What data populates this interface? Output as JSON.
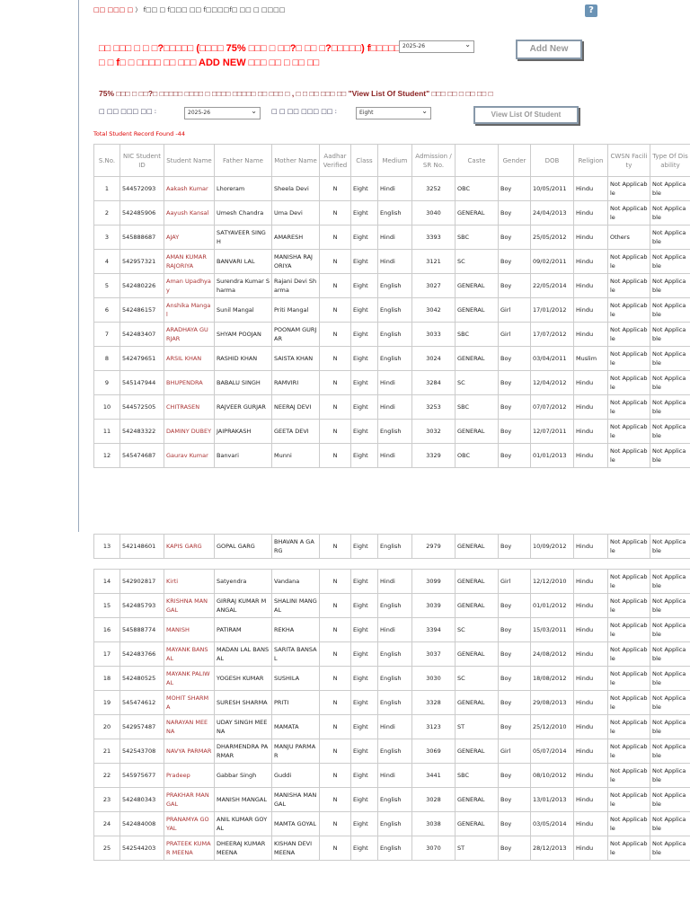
{
  "breadcrumb": {
    "home": "□□ □□□ □",
    "current": "f□□ □ f□□□ □□ f□□□□f□ □□ □ □□□□"
  },
  "help_icon": "?",
  "notice": "□□ □□□ □ □ □?□□□□□ (□□□□ 75% □□□ □ □□?□ □□ □?□□□□□) f□□□□□ □ □ f□ □ □□□□ □□ □□□ ADD NEW □□□ □□ □ □□ □□",
  "year_select": "2025-26",
  "add_new": "Add New",
  "info": "75% □□□ □ □□?□ □□□□□ □□□□ □ □□□□ □□□□□ □□ □□□ □ , □ □ □□ □□□ □□ \"View List Of Student\" □□□ □□ □ □□ □□ □",
  "filter": {
    "year_label": "□ □□ □□□ □□ :",
    "year_value": "2025-26",
    "class_label": "□ □ □□ □□□ □□ :",
    "class_value": "Eight",
    "view_button": "View List Of Student"
  },
  "total": "Total Student Record Found -44",
  "headers": [
    "S.No.",
    "NIC Student ID",
    "Student Name",
    "Father Name",
    "Mother Name",
    "Aadhar Verified",
    "Class",
    "Medium",
    "Admission / SR No.",
    "Caste",
    "Gender",
    "DOB",
    "Religion",
    "CWSN Facility",
    "Type Of Disability"
  ],
  "rows": [
    [
      "1",
      "544572093",
      "Aakash Kumar",
      "Lhoreram",
      "Sheela Devi",
      "N",
      "Eight",
      "Hindi",
      "3252",
      "OBC",
      "Boy",
      "10/05/2011",
      "Hindu",
      "Not Applicable",
      "Not Applicable"
    ],
    [
      "2",
      "542485906",
      "Aayush Kansal",
      "Umesh Chandra",
      "Uma Devi",
      "N",
      "Eight",
      "English",
      "3040",
      "GENERAL",
      "Boy",
      "24/04/2013",
      "Hindu",
      "Not Applicable",
      "Not Applicable"
    ],
    [
      "3",
      "545888687",
      "AJAY",
      "SATYAVEER SINGH",
      "AMARESH",
      "N",
      "Eight",
      "Hindi",
      "3393",
      "SBC",
      "Boy",
      "25/05/2012",
      "Hindu",
      "Others",
      "Not Applicable"
    ],
    [
      "4",
      "542957321",
      "AMAN KUMAR RAJORIYA",
      "BANVARI LAL",
      "MANISHA RAJORIYA",
      "N",
      "Eight",
      "Hindi",
      "3121",
      "SC",
      "Boy",
      "09/02/2011",
      "Hindu",
      "Not Applicable",
      "Not Applicable"
    ],
    [
      "5",
      "542480226",
      "Aman Upadhyay",
      "Surendra Kumar Sharma",
      "Rajani Devi Sharma",
      "N",
      "Eight",
      "English",
      "3027",
      "GENERAL",
      "Boy",
      "22/05/2014",
      "Hindu",
      "Not Applicable",
      "Not Applicable"
    ],
    [
      "6",
      "542486157",
      "Anshika Mangal",
      "Sunil Mangal",
      "Priti Mangal",
      "N",
      "Eight",
      "English",
      "3042",
      "GENERAL",
      "Girl",
      "17/01/2012",
      "Hindu",
      "Not Applicable",
      "Not Applicable"
    ],
    [
      "7",
      "542483407",
      "ARADHAYA GURJAR",
      "SHYAM POOJAN",
      "POONAM GURJAR",
      "N",
      "Eight",
      "English",
      "3033",
      "SBC",
      "Girl",
      "17/07/2012",
      "Hindu",
      "Not Applicable",
      "Not Applicable"
    ],
    [
      "8",
      "542479651",
      "ARSIL KHAN",
      "RASHID KHAN",
      "SAISTA KHAN",
      "N",
      "Eight",
      "English",
      "3024",
      "GENERAL",
      "Boy",
      "03/04/2011",
      "Muslim",
      "Not Applicable",
      "Not Applicable"
    ],
    [
      "9",
      "545147944",
      "BHUPENDRA",
      "BABALU SINGH",
      "RAMVIRI",
      "N",
      "Eight",
      "Hindi",
      "3284",
      "SC",
      "Boy",
      "12/04/2012",
      "Hindu",
      "Not Applicable",
      "Not Applicable"
    ],
    [
      "10",
      "544572505",
      "CHITRASEN",
      "RAJVEER GURJAR",
      "NEERAJ DEVI",
      "N",
      "Eight",
      "Hindi",
      "3253",
      "SBC",
      "Boy",
      "07/07/2012",
      "Hindu",
      "Not Applicable",
      "Not Applicable"
    ],
    [
      "11",
      "542483322",
      "DAMINY DUBEY",
      "JAIPRAKASH",
      "GEETA DEVI",
      "N",
      "Eight",
      "English",
      "3032",
      "GENERAL",
      "Boy",
      "12/07/2011",
      "Hindu",
      "Not Applicable",
      "Not Applicable"
    ],
    [
      "12",
      "545474687",
      "Gaurav Kumar",
      "Banvari",
      "Munni",
      "N",
      "Eight",
      "Hindi",
      "3329",
      "OBC",
      "Boy",
      "01/01/2013",
      "Hindu",
      "Not Applicable",
      "Not Applicable"
    ],
    [
      "13",
      "542148601",
      "KAPIS GARG",
      "GOPAL GARG",
      "BHAVAN A GARG",
      "N",
      "Eight",
      "English",
      "2979",
      "GENERAL",
      "Boy",
      "10/09/2012",
      "Hindu",
      "Not Applicable",
      "Not Applicable"
    ],
    [
      "14",
      "542902817",
      "Kirti",
      "Satyendra",
      "Vandana",
      "N",
      "Eight",
      "Hindi",
      "3099",
      "GENERAL",
      "Girl",
      "12/12/2010",
      "Hindu",
      "Not Applicable",
      "Not Applicable"
    ],
    [
      "15",
      "542485793",
      "KRISHNA MANGAL",
      "GIRRAJ KUMAR MANGAL",
      "SHALINI MANGAL",
      "N",
      "Eight",
      "English",
      "3039",
      "GENERAL",
      "Boy",
      "01/01/2012",
      "Hindu",
      "Not Applicable",
      "Not Applicable"
    ],
    [
      "16",
      "545888774",
      "MANISH",
      "PATIRAM",
      "REKHA",
      "N",
      "Eight",
      "Hindi",
      "3394",
      "SC",
      "Boy",
      "15/03/2011",
      "Hindu",
      "Not Applicable",
      "Not Applicable"
    ],
    [
      "17",
      "542483766",
      "MAYANK BANSAL",
      "MADAN LAL BANSAL",
      "SARITA BANSAL",
      "N",
      "Eight",
      "English",
      "3037",
      "GENERAL",
      "Boy",
      "24/08/2012",
      "Hindu",
      "Not Applicable",
      "Not Applicable"
    ],
    [
      "18",
      "542480525",
      "MAYANK PALIWAL",
      "YOGESH KUMAR",
      "SUSHILA",
      "N",
      "Eight",
      "English",
      "3030",
      "SC",
      "Boy",
      "18/08/2012",
      "Hindu",
      "Not Applicable",
      "Not Applicable"
    ],
    [
      "19",
      "545474612",
      "MOHIT SHARMA",
      "SURESH SHARMA",
      "PRITI",
      "N",
      "Eight",
      "English",
      "3328",
      "GENERAL",
      "Boy",
      "29/08/2013",
      "Hindu",
      "Not Applicable",
      "Not Applicable"
    ],
    [
      "20",
      "542957487",
      "NARAYAN MEENA",
      "UDAY SINGH MEENA",
      "MAMATA",
      "N",
      "Eight",
      "Hindi",
      "3123",
      "ST",
      "Boy",
      "25/12/2010",
      "Hindu",
      "Not Applicable",
      "Not Applicable"
    ],
    [
      "21",
      "542543708",
      "NAVYA PARMAR",
      "DHARMENDRA PARMAR",
      "MANJU PARMAR",
      "N",
      "Eight",
      "English",
      "3069",
      "GENERAL",
      "Girl",
      "05/07/2014",
      "Hindu",
      "Not Applicable",
      "Not Applicable"
    ],
    [
      "22",
      "545975677",
      "Pradeep",
      "Gabbar Singh",
      "Guddi",
      "N",
      "Eight",
      "Hindi",
      "3441",
      "SBC",
      "Boy",
      "08/10/2012",
      "Hindu",
      "Not Applicable",
      "Not Applicable"
    ],
    [
      "23",
      "542480343",
      "PRAKHAR MANGAL",
      "MANISH MANGAL",
      "MANISHA MANGAL",
      "N",
      "Eight",
      "English",
      "3028",
      "GENERAL",
      "Boy",
      "13/01/2013",
      "Hindu",
      "Not Applicable",
      "Not Applicable"
    ],
    [
      "24",
      "542484008",
      "PRANAMYA GOYAL",
      "ANIL KUMAR GOYAL",
      "MAMTA GOYAL",
      "N",
      "Eight",
      "English",
      "3038",
      "GENERAL",
      "Boy",
      "03/05/2014",
      "Hindu",
      "Not Applicable",
      "Not Applicable"
    ],
    [
      "25",
      "542544203",
      "PRATEEK KUMAR MEENA",
      "DHEERAJ KUMAR MEENA",
      "KISHAN DEVI MEENA",
      "N",
      "Eight",
      "English",
      "3070",
      "ST",
      "Boy",
      "28/12/2013",
      "Hindu",
      "Not Applicable",
      "Not Applicable"
    ]
  ]
}
